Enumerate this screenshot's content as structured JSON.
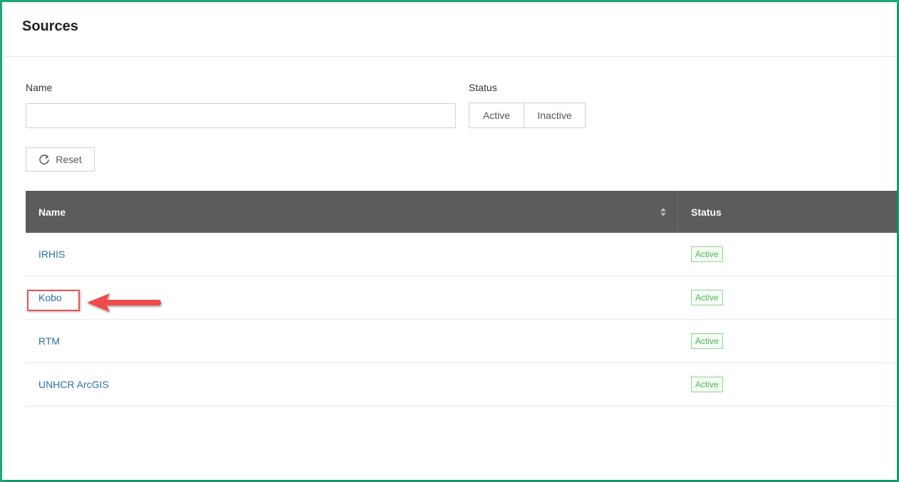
{
  "page": {
    "title": "Sources"
  },
  "filters": {
    "name_label": "Name",
    "name_value": "",
    "name_placeholder": "",
    "status_label": "Status",
    "status_options": [
      "Active",
      "Inactive"
    ],
    "reset_label": "Reset"
  },
  "table": {
    "columns": [
      "Name",
      "Status"
    ],
    "rows": [
      {
        "name": "IRHIS",
        "status": "Active"
      },
      {
        "name": "Kobo",
        "status": "Active"
      },
      {
        "name": "RTM",
        "status": "Active"
      },
      {
        "name": "UNHCR ArcGIS",
        "status": "Active"
      }
    ]
  },
  "colors": {
    "frame": "#1fa67a",
    "header_bg": "#5c5c5c",
    "link": "#2f6ea8",
    "badge_green": "#49b649",
    "annotation_red": "#e05555"
  },
  "icons": {
    "reset": "refresh-icon",
    "sort": "sort-icon",
    "annotation": "arrow-left-icon"
  }
}
